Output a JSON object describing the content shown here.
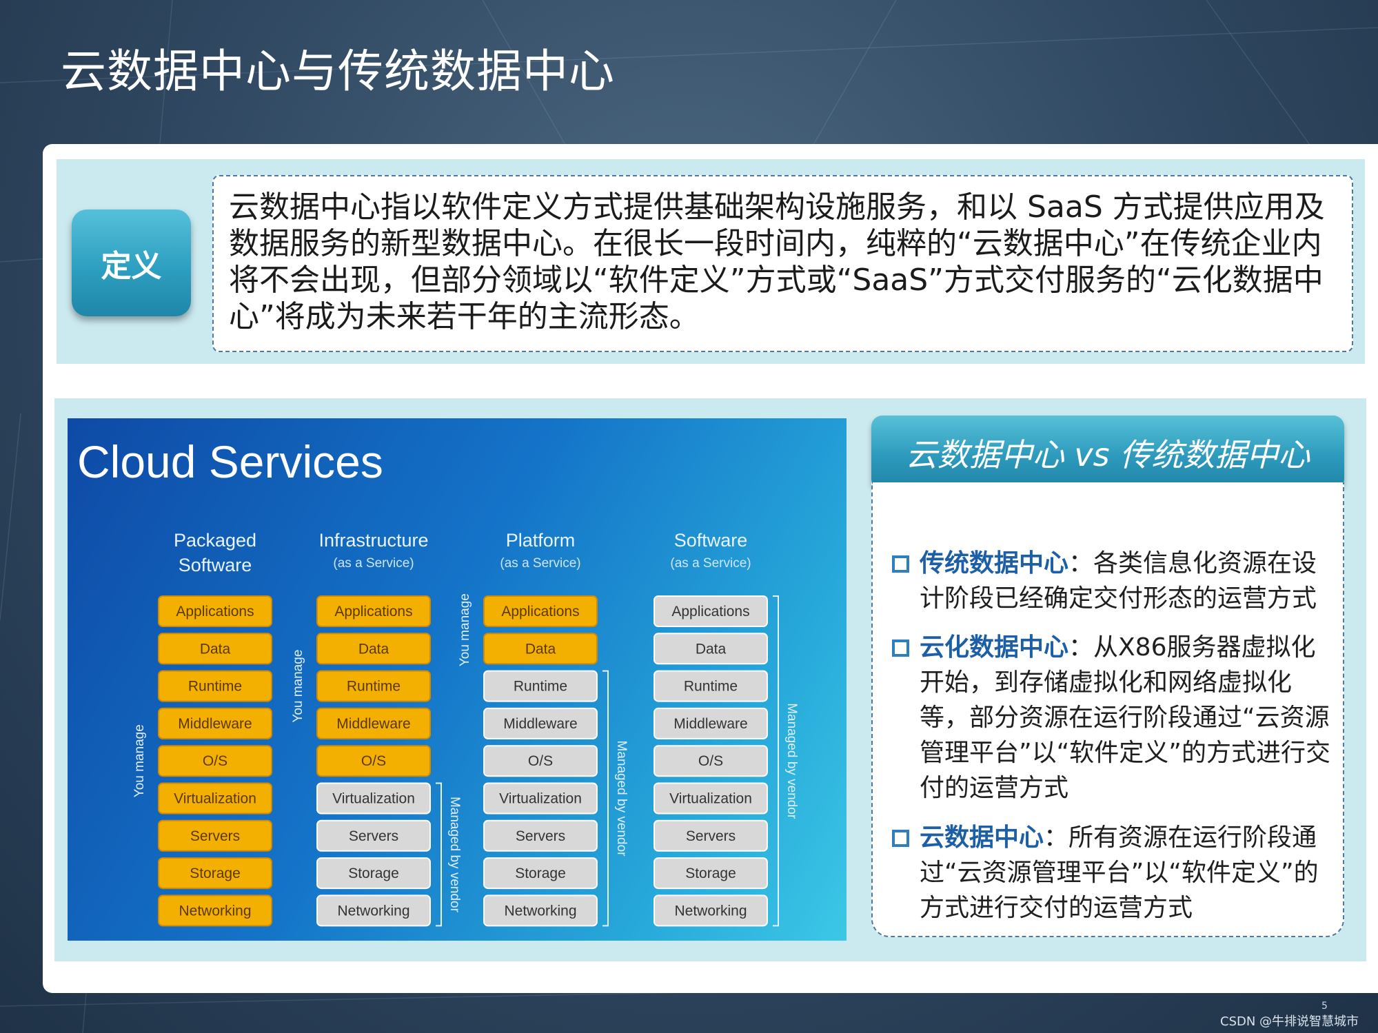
{
  "title": "云数据中心与传统数据中心",
  "definition": {
    "label": "定义",
    "text": "云数据中心指以软件定义方式提供基础架构设施服务，和以 SaaS 方式提供应用及数据服务的新型数据中心。在很长一段时间内，纯粹的“云数据中心”在传统企业内将不会出现，但部分领域以“软件定义”方式或“SaaS”方式交付服务的“云化数据中心”将成为未来若干年的主流形态。"
  },
  "cloud_image": {
    "heading": "Cloud Services",
    "layers": [
      "Applications",
      "Data",
      "Runtime",
      "Middleware",
      "O/S",
      "Virtualization",
      "Servers",
      "Storage",
      "Networking"
    ],
    "columns": [
      {
        "title_lines": [
          "Packaged",
          "Software"
        ],
        "subtitle": "",
        "user_managed_count": 9,
        "you_manage_label": "You manage",
        "vendor_label": ""
      },
      {
        "title_lines": [
          "Infrastructure"
        ],
        "subtitle": "(as a Service)",
        "user_managed_count": 5,
        "you_manage_label": "You manage",
        "vendor_label": "Managed by vendor"
      },
      {
        "title_lines": [
          "Platform"
        ],
        "subtitle": "(as a Service)",
        "user_managed_count": 2,
        "you_manage_label": "You manage",
        "vendor_label": "Managed by vendor"
      },
      {
        "title_lines": [
          "Software"
        ],
        "subtitle": "(as a Service)",
        "user_managed_count": 0,
        "you_manage_label": "",
        "vendor_label": "Managed by vendor"
      }
    ],
    "colors": {
      "user_managed": "#f4b000",
      "vendor_managed": "#d8d8d8"
    }
  },
  "comparison": {
    "header": "云数据中心 vs 传统数据中心",
    "items": [
      {
        "term": "传统数据中心",
        "desc": "：各类信息化资源在设计阶段已经确定交付形态的运营方式"
      },
      {
        "term": "云化数据中心",
        "desc": "：从X86服务器虚拟化开始，到存储虚拟化和网络虚拟化等，部分资源在运行阶段通过“云资源管理平台”以“软件定义”的方式进行交付的运营方式"
      },
      {
        "term": "云数据中心",
        "desc": "：所有资源在运行阶段通过“云资源管理平台”以“软件定义”的方式进行交付的运营方式"
      }
    ]
  },
  "footer": {
    "credit": "CSDN @牛排说智慧城市",
    "page_number": "5"
  },
  "theme": {
    "accent": "#2d9fc0",
    "term_color": "#1d5fa6",
    "panel_bg": "#cbeaf0"
  }
}
